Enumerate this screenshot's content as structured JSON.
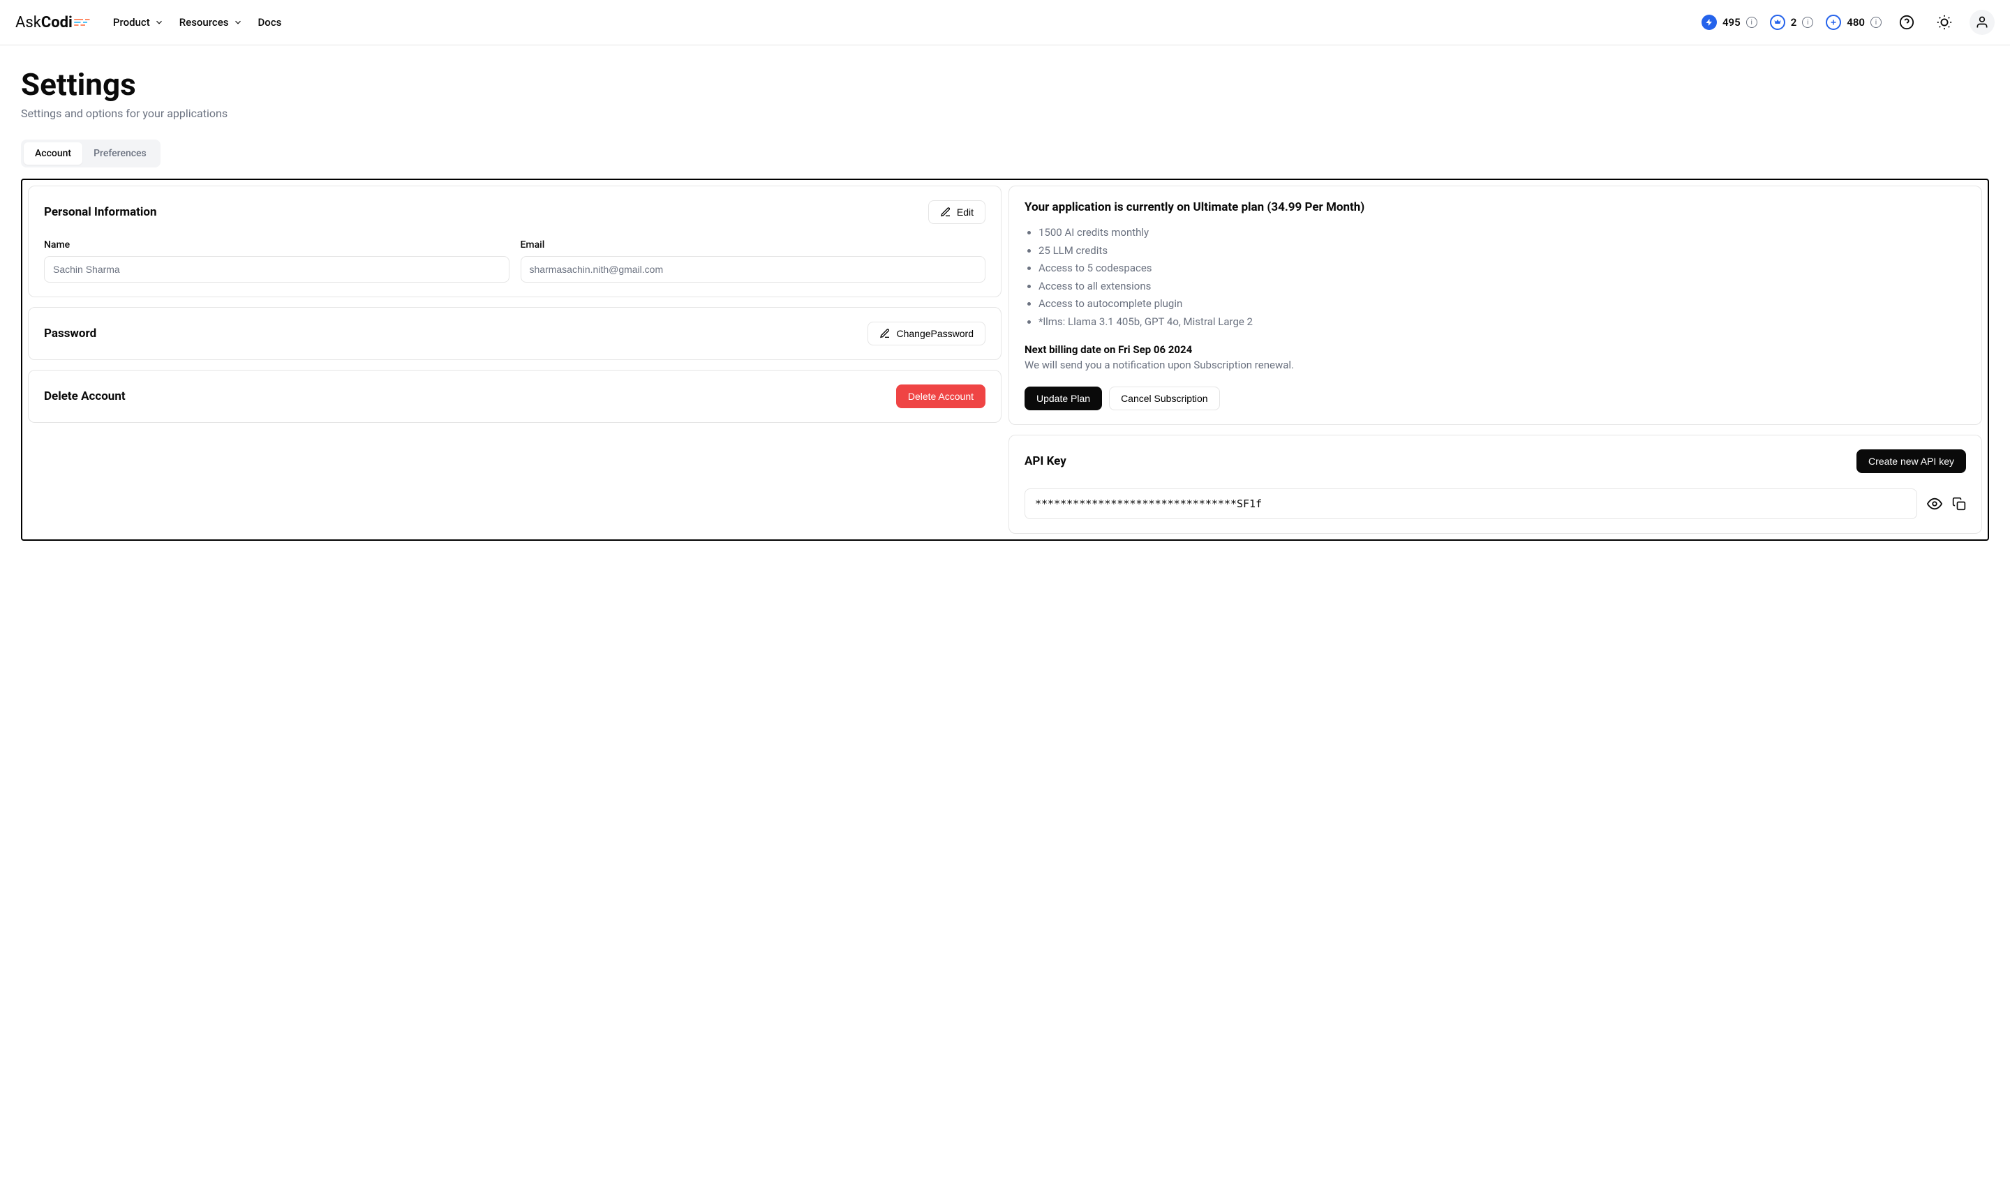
{
  "header": {
    "logo_part1": "Ask",
    "logo_part2": "Codi",
    "nav": {
      "product": "Product",
      "resources": "Resources",
      "docs": "Docs"
    },
    "credits": {
      "bolt": "495",
      "crown": "2",
      "plus": "480"
    }
  },
  "page": {
    "title": "Settings",
    "subtitle": "Settings and options for your applications"
  },
  "tabs": {
    "account": "Account",
    "preferences": "Preferences"
  },
  "personal": {
    "section_title": "Personal Information",
    "edit_label": "Edit",
    "name_label": "Name",
    "name_value": "Sachin Sharma",
    "email_label": "Email",
    "email_value": "sharmasachin.nith@gmail.com"
  },
  "password": {
    "section_title": "Password",
    "change_label": "ChangePassword"
  },
  "delete": {
    "section_title": "Delete Account",
    "button_label": "Delete Account"
  },
  "plan": {
    "title": "Your application is currently on Ultimate plan (34.99 Per Month)",
    "features": [
      "1500 AI credits monthly",
      "25 LLM credits",
      "Access to 5 codespaces",
      "Access to all extensions",
      "Access to autocomplete plugin",
      "*llms: Llama 3.1 405b, GPT 4o, Mistral Large 2"
    ],
    "billing_date": "Next billing date on Fri Sep 06 2024",
    "billing_note": "We will send you a notification upon Subscription renewal.",
    "update_label": "Update Plan",
    "cancel_label": "Cancel Subscription"
  },
  "api": {
    "section_title": "API Key",
    "create_label": "Create new API key",
    "key_value": "********************************SF1f"
  }
}
